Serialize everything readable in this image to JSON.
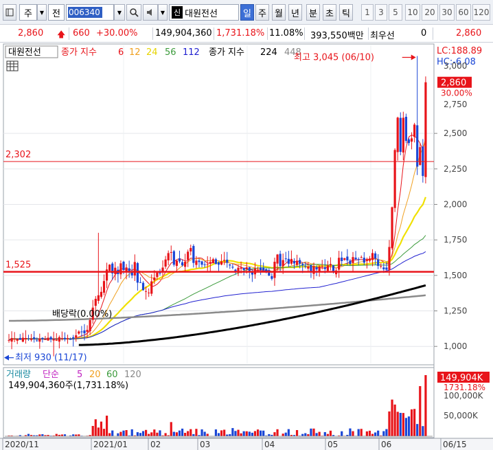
{
  "toolbar": {
    "market": "주",
    "code_label": "전",
    "code": "006340",
    "badge": "신",
    "stock_name": "대원전선",
    "periods": [
      "일",
      "주",
      "월",
      "년",
      "분",
      "초",
      "틱"
    ],
    "active_period": "일",
    "numbers": [
      "1",
      "3",
      "5",
      "10",
      "20",
      "30",
      "60",
      "120"
    ]
  },
  "quote": {
    "price": "2,860",
    "change": "660",
    "change_rate": "+30.00%",
    "volume": "149,904,360",
    "volume_rate": "1,731.18%",
    "turnover": "11.08%",
    "amount": "393,550백만",
    "pref_label": "최우선",
    "pref_value": "0",
    "last": "2,860"
  },
  "price_panel": {
    "stock_tag": "대원전선",
    "ma_label": "종가 지수",
    "ma_periods": [
      "6",
      "12",
      "24",
      "56",
      "112"
    ],
    "ma2_label": "종가 지수",
    "ma2_periods": [
      "224",
      "448"
    ],
    "lc_label": "LC:188.89",
    "hc_label": "HC:-6.08",
    "high_annotation": "최고 3,045 (06/10)",
    "low_annotation": "최저 930 (11/17)",
    "dividend_annotation": "배당락(0.00%)",
    "line_2302": "2,302",
    "line_1525": "1,525",
    "current_price_tag": "2,860",
    "current_rate_tag": "30.00%",
    "partial_top_tick": "3,000",
    "partial_tick": "2,750"
  },
  "volume_panel": {
    "label": "거래량",
    "ma_label": "단순",
    "ma_periods": [
      "5",
      "20",
      "60",
      "120"
    ],
    "readout": "149,904,360주(1,731.18%)",
    "current_tag": "149,904K",
    "current_rate": "1731.18%",
    "partial_tick": "100,000K",
    "tick_50k": "50,000K"
  },
  "colors": {
    "up": "#e8141a",
    "down": "#1a46d6",
    "ma6": "#e8141a",
    "ma12": "#f0a020",
    "ma24": "#f0e000",
    "ma56": "#3a9a3a",
    "ma112": "#2020d0",
    "ma224": "#000000",
    "ma448": "#8a8a8a"
  },
  "chart_data": {
    "type": "candlestick",
    "price_axis": {
      "ticks": [
        1000,
        1250,
        1500,
        1750,
        2000,
        2250,
        2500
      ],
      "ylim": [
        880,
        3120
      ]
    },
    "volume_axis": {
      "ticks": [
        "50,000K"
      ]
    },
    "x_labels": [
      "2020/11",
      "2021/01",
      "02",
      "03",
      "04",
      "05",
      "06",
      "06/15"
    ],
    "reference_lines": [
      2302,
      1525
    ],
    "high": {
      "value": 3045,
      "date": "06/10"
    },
    "low": {
      "value": 930,
      "date": "11/17"
    },
    "last_price": 2860
  }
}
